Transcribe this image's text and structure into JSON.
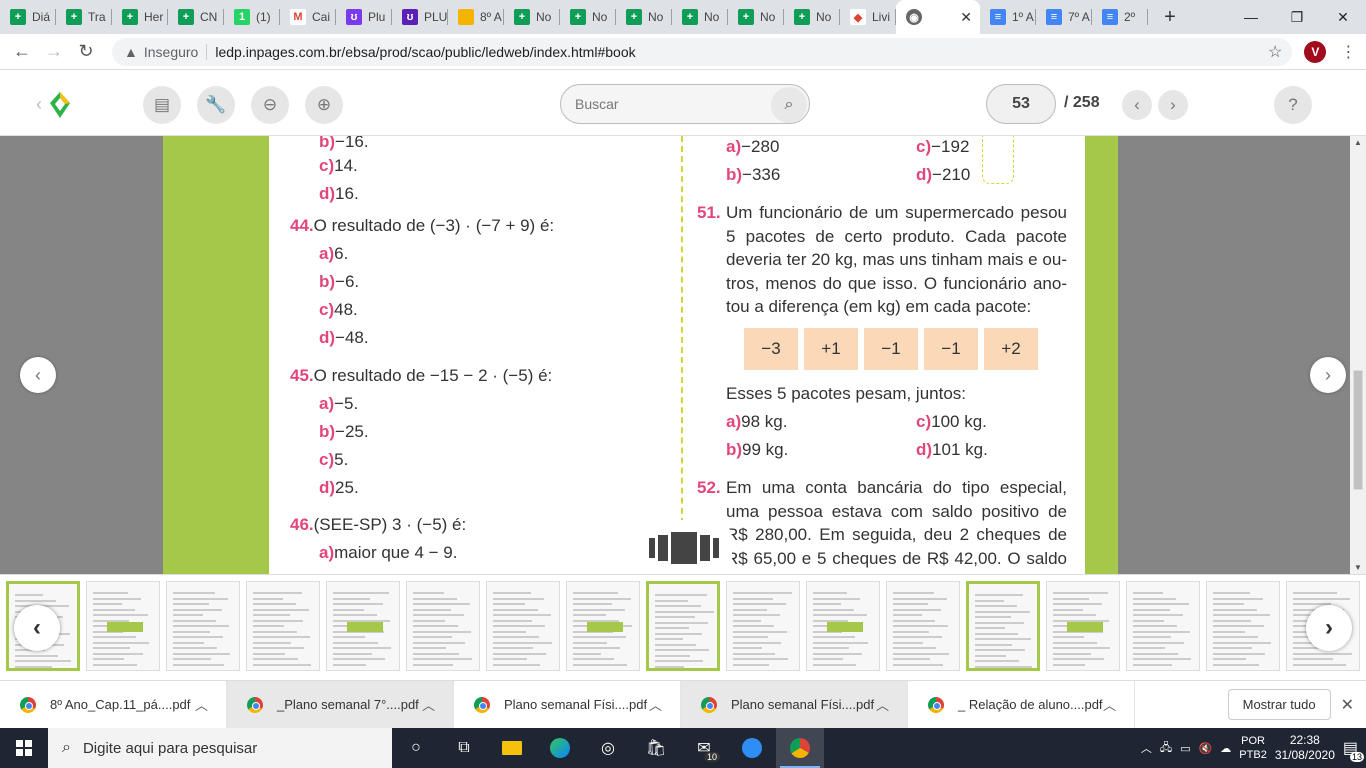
{
  "browser": {
    "tabs": [
      {
        "label": "Diá",
        "icon": "+",
        "color": "#0f9d58"
      },
      {
        "label": "Tra",
        "icon": "+",
        "color": "#0f9d58"
      },
      {
        "label": "Her",
        "icon": "+",
        "color": "#0f9d58"
      },
      {
        "label": "CN",
        "icon": "+",
        "color": "#0f9d58"
      },
      {
        "label": "(1)",
        "icon": "1",
        "color": "#25d366"
      },
      {
        "label": "Cai",
        "icon": "M",
        "color": "#ffffff"
      },
      {
        "label": "Plu",
        "icon": "ʊ",
        "color": "#7c3aed"
      },
      {
        "label": "PLU",
        "icon": "ʊ",
        "color": "#5b21b6"
      },
      {
        "label": "8º A",
        "icon": "",
        "color": "#f4b400"
      },
      {
        "label": "No",
        "icon": "+",
        "color": "#0f9d58"
      },
      {
        "label": "No",
        "icon": "+",
        "color": "#0f9d58"
      },
      {
        "label": "No",
        "icon": "+",
        "color": "#0f9d58"
      },
      {
        "label": "No",
        "icon": "+",
        "color": "#0f9d58"
      },
      {
        "label": "No",
        "icon": "+",
        "color": "#0f9d58"
      },
      {
        "label": "No",
        "icon": "+",
        "color": "#0f9d58"
      },
      {
        "label": "Livi",
        "icon": "◆",
        "color": "#ffffff"
      }
    ],
    "active_tab": {
      "close": "✕"
    },
    "tabs_after": [
      {
        "label": "1º A",
        "icon": "≡",
        "color": "#4285f4"
      },
      {
        "label": "7º A",
        "icon": "≡",
        "color": "#4285f4"
      },
      {
        "label": "2º",
        "icon": "≡",
        "color": "#4285f4"
      }
    ],
    "new_tab": "+",
    "window_controls": [
      "—",
      "❐",
      "✕"
    ],
    "security": "Inseguro",
    "url": "ledp.inpages.com.br/ebsa/prod/scao/public/ledweb/index.html#book",
    "avatar": "V"
  },
  "reader": {
    "search_placeholder": "Buscar",
    "current_page": "53",
    "total_pages": "/ 258"
  },
  "book": {
    "left": [
      {
        "opt": "b)",
        "text": "−16."
      },
      {
        "opt": "c)",
        "text": "14."
      },
      {
        "opt": "d)",
        "text": "16."
      }
    ],
    "q44": {
      "num": "44.",
      "text": "O resultado de (−3) · (−7 + 9) é:",
      "options": [
        {
          "opt": "a)",
          "text": "6."
        },
        {
          "opt": "b)",
          "text": "−6."
        },
        {
          "opt": "c)",
          "text": "48."
        },
        {
          "opt": "d)",
          "text": "−48."
        }
      ]
    },
    "q45": {
      "num": "45.",
      "text": "O resultado de −15 − 2 · (−5) é:",
      "options": [
        {
          "opt": "a)",
          "text": "−5."
        },
        {
          "opt": "b)",
          "text": "−25."
        },
        {
          "opt": "c)",
          "text": "5."
        },
        {
          "opt": "d)",
          "text": "25."
        }
      ]
    },
    "q46": {
      "num": "46.",
      "text": "(SEE-SP) 3 · (−5) é:",
      "options": [
        {
          "opt": "a)",
          "text": "maior que 4 − 9."
        }
      ]
    },
    "q50_opts": [
      {
        "opt": "a)",
        "text": "−280"
      },
      {
        "opt": "c)",
        "text": "−192"
      },
      {
        "opt": "b)",
        "text": "−336"
      },
      {
        "opt": "d)",
        "text": "−210"
      }
    ],
    "q51": {
      "num": "51.",
      "lines": [
        "Um funcionário de um supermercado pesou",
        "5 pacotes de certo produto. Cada pacote",
        "deveria ter 20 kg, mas uns tinham mais e ou-",
        "tros, menos do que isso. O funcionário ano-",
        "tou a diferença (em kg) em cada pacote:"
      ],
      "cells": [
        "−3",
        "+1",
        "−1",
        "−1",
        "+2"
      ],
      "question": "Esses 5 pacotes pesam, juntos:",
      "options": [
        {
          "opt": "a)",
          "text": "98 kg."
        },
        {
          "opt": "c)",
          "text": "100 kg."
        },
        {
          "opt": "b)",
          "text": "99 kg."
        },
        {
          "opt": "d)",
          "text": "101 kg."
        }
      ]
    },
    "q52": {
      "num": "52.",
      "lines": [
        "Em uma conta bancária do tipo especial,",
        "uma pessoa estava com saldo positivo de",
        "R$ 280,00. Em seguida, deu 2 cheques de",
        "R$ 65,00 e 5 cheques de R$ 42,00. O saldo"
      ]
    }
  },
  "downloads": {
    "items": [
      "8º Ano_Cap.11_pá....pdf",
      "_Plano semanal 7°....pdf",
      "Plano semanal Físi....pdf",
      "Plano semanal Físi....pdf",
      "_ Relação de aluno....pdf"
    ],
    "show_all": "Mostrar tudo"
  },
  "taskbar": {
    "search_placeholder": "Digite aqui para pesquisar",
    "mail_badge": "10",
    "lang": "POR",
    "layout": "PTB2",
    "time": "22:38",
    "date": "31/08/2020",
    "notifications": "13"
  }
}
